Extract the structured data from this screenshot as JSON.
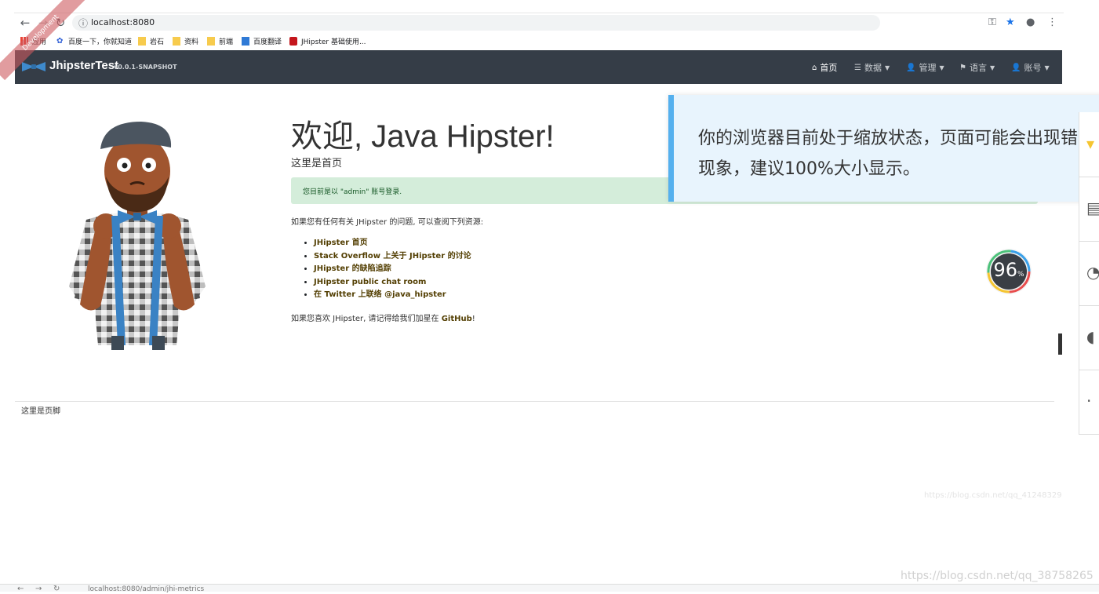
{
  "browser": {
    "url": "localhost:8080",
    "bookmarks": [
      "应用",
      "百度一下，你就知道",
      "岩石",
      "资料",
      "前端",
      "百度翻译",
      "JHipster 基础使用..."
    ]
  },
  "navbar": {
    "brand": "JhipsterTest",
    "version": "v0.0.1-SNAPSHOT",
    "ribbon": "Development",
    "menu": [
      "首页",
      "数据",
      "管理",
      "语言",
      "账号"
    ]
  },
  "home": {
    "title": "欢迎, Java Hipster!",
    "subtitle": "这里是首页",
    "alert": "您目前是以 \"admin\" 账号登录.",
    "question": "如果您有任何有关 JHipster 的问题, 可以查阅下列资源:",
    "links": [
      "JHipster 首页",
      "Stack Overflow 上关于 JHipster 的讨论",
      "JHipster 的缺陷追踪",
      "JHipster public chat room",
      "在 Twitter 上联络 @java_hipster"
    ],
    "like_prefix": "如果您喜欢 JHipster, 请记得给我们加星在 ",
    "github": "GitHub",
    "like_suffix": "!"
  },
  "footer": "这里是页脚",
  "zoom_notice": "你的浏览器目前处于缩放状态，页面可能会出现错位现象，建议100%大小显示。",
  "gauge": {
    "value": "96",
    "unit": "%"
  },
  "watermarks": [
    "https://blog.csdn.net/qq_41248329",
    "https://blog.csdn.net/qq_38758265"
  ],
  "bottom_url": "localhost:8080/admin/jhi-metrics",
  "colors": {
    "navbar": "#353d47",
    "alert_bg": "#d4edda",
    "notice_border": "#55b0ee",
    "link": "#533f03"
  }
}
